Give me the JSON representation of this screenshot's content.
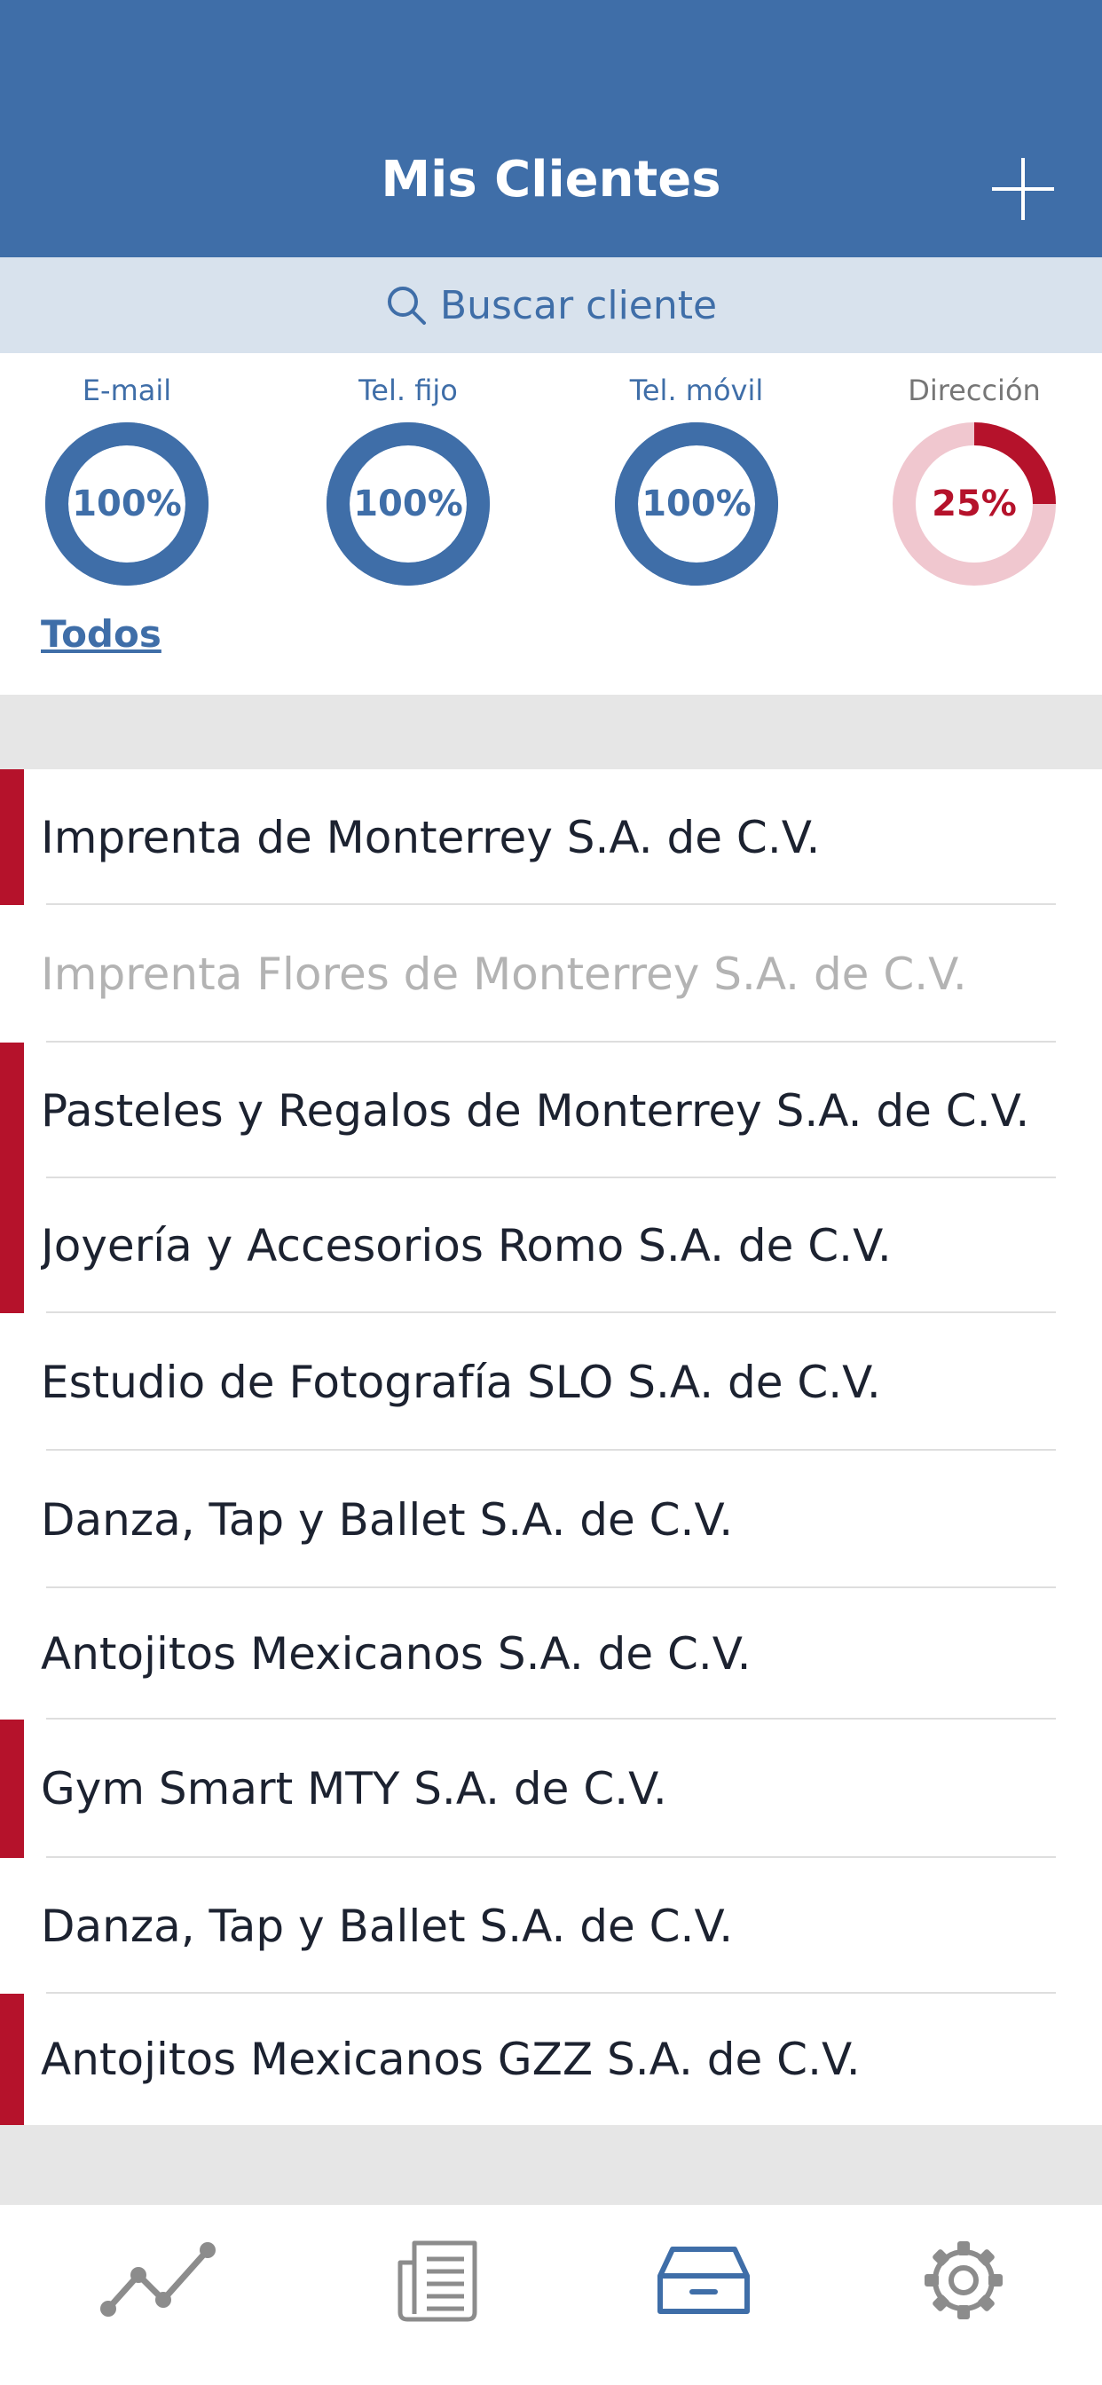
{
  "header": {
    "title": "Mis Clientes",
    "add_icon": "plus-icon"
  },
  "search": {
    "icon": "search-icon",
    "placeholder": "Buscar cliente"
  },
  "stats": [
    {
      "label": "E-mail",
      "value": "100%",
      "percent": 100,
      "color": "#3f6ea8",
      "status": "complete"
    },
    {
      "label": "Tel. fijo",
      "value": "100%",
      "percent": 100,
      "color": "#3f6ea8",
      "status": "complete"
    },
    {
      "label": "Tel. móvil",
      "value": "100%",
      "percent": 100,
      "color": "#3f6ea8",
      "status": "complete"
    },
    {
      "label": "Dirección",
      "value": "25%",
      "percent": 25,
      "color": "#b5122b",
      "track_color": "#f0c7cf",
      "status": "incomplete"
    }
  ],
  "filter": {
    "todos_label": "Todos"
  },
  "clients": [
    {
      "name": "Imprenta de Monterrey S.A. de C.V.",
      "flagged": true,
      "inactive": false
    },
    {
      "name": "Imprenta Flores de Monterrey S.A. de C.V.",
      "flagged": false,
      "inactive": true
    },
    {
      "name": "Pasteles y Regalos de Monterrey S.A. de C.V.",
      "flagged": true,
      "inactive": false
    },
    {
      "name": "Joyería y Accesorios Romo S.A. de C.V.",
      "flagged": true,
      "inactive": false
    },
    {
      "name": "Estudio de Fotografía SLO S.A. de C.V.",
      "flagged": false,
      "inactive": false
    },
    {
      "name": "Danza, Tap y Ballet S.A. de C.V.",
      "flagged": false,
      "inactive": false
    },
    {
      "name": "Antojitos Mexicanos S.A. de C.V.",
      "flagged": false,
      "inactive": false
    },
    {
      "name": "Gym Smart MTY S.A. de C.V.",
      "flagged": true,
      "inactive": false
    },
    {
      "name": "Danza, Tap y Ballet S.A. de C.V.",
      "flagged": false,
      "inactive": false
    },
    {
      "name": "Antojitos Mexicanos GZZ S.A. de C.V.",
      "flagged": true,
      "inactive": false
    }
  ],
  "tabbar": {
    "tabs": [
      {
        "icon": "line-chart-icon",
        "active": false
      },
      {
        "icon": "newspaper-icon",
        "active": false
      },
      {
        "icon": "inbox-tray-icon",
        "active": true
      },
      {
        "icon": "gear-icon",
        "active": false
      }
    ]
  },
  "colors": {
    "primary": "#3f6ea8",
    "alert": "#b5122b",
    "inactive_text": "#b3b3b3",
    "tab_inactive": "#8c8c8c"
  }
}
